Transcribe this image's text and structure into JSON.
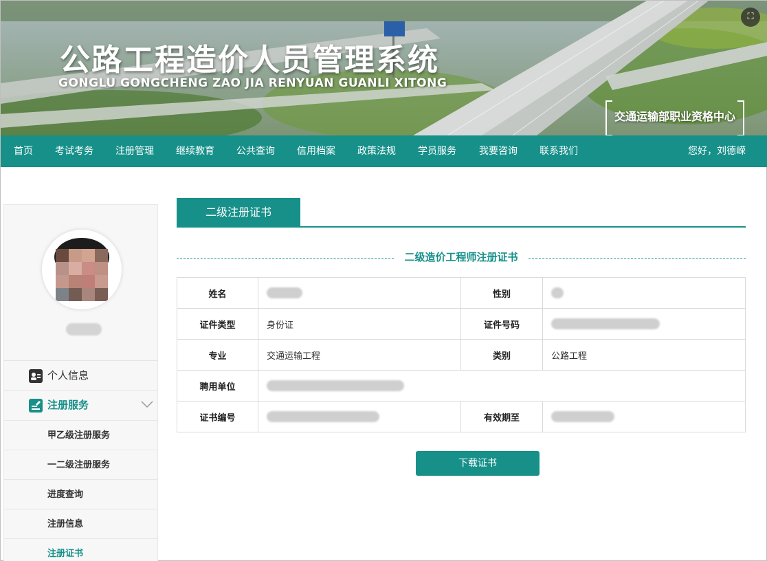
{
  "header": {
    "title": "公路工程造价人员管理系统",
    "subtitle": "GONGLU GONGCHENG ZAO JIA RENYUAN GUANLI XITONG",
    "org": "交通运输部职业资格中心",
    "corner_icon": "expand-icon"
  },
  "nav": {
    "items": [
      "首页",
      "考试考务",
      "注册管理",
      "继续教育",
      "公共查询",
      "信用档案",
      "政策法规",
      "学员服务",
      "我要咨询",
      "联系我们"
    ],
    "user_greeting": "您好，刘德嵘"
  },
  "sidebar": {
    "menu": [
      {
        "label": "个人信息",
        "icon": "id-card-icon"
      },
      {
        "label": "注册服务",
        "icon": "edit-icon"
      }
    ],
    "submenu": [
      "甲乙级注册服务",
      "一二级注册服务",
      "进度查询",
      "注册信息",
      "注册证书"
    ]
  },
  "main": {
    "tab_label": "二级注册证书",
    "cert_title": "二级造价工程师注册证书",
    "fields": {
      "name_label": "姓名",
      "gender_label": "性别",
      "id_type_label": "证件类型",
      "id_type_value": "身份证",
      "id_no_label": "证件号码",
      "major_label": "专业",
      "major_value": "交通运输工程",
      "category_label": "类别",
      "category_value": "公路工程",
      "employer_label": "聘用单位",
      "cert_no_label": "证书编号",
      "valid_until_label": "有效期至"
    },
    "download_button": "下载证书"
  },
  "colors": {
    "accent": "#17908a",
    "active_text": "#17908a"
  }
}
